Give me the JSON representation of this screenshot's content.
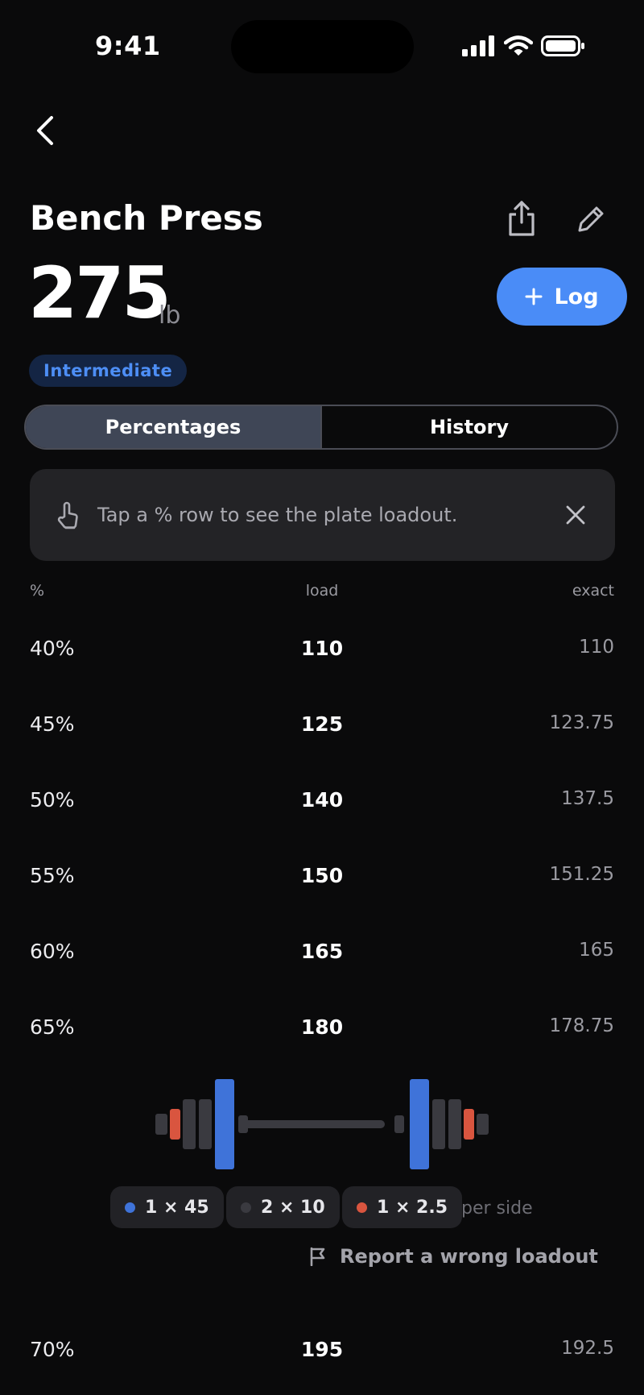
{
  "status_bar": {
    "time": "9:41"
  },
  "header": {
    "title": "Bench Press",
    "weight": "275",
    "unit": "lb",
    "log_label": "Log",
    "level_badge": "Intermediate"
  },
  "tabs": [
    {
      "label": "Percentages",
      "active": true
    },
    {
      "label": "History",
      "active": false
    }
  ],
  "tip": {
    "text": "Tap a % row to see the plate loadout."
  },
  "table": {
    "columns": {
      "pct": "%",
      "load": "load",
      "exact": "exact"
    },
    "rows": [
      {
        "pct": "40%",
        "load": "110",
        "exact": "110"
      },
      {
        "pct": "45%",
        "load": "125",
        "exact": "123.75"
      },
      {
        "pct": "50%",
        "load": "140",
        "exact": "137.5"
      },
      {
        "pct": "55%",
        "load": "150",
        "exact": "151.25"
      },
      {
        "pct": "60%",
        "load": "165",
        "exact": "165"
      },
      {
        "pct": "65%",
        "load": "180",
        "exact": "178.75"
      },
      {
        "pct": "70%",
        "load": "195",
        "exact": "192.5"
      }
    ]
  },
  "loadout": {
    "plates": [
      {
        "label": "1 × 45",
        "color": "#3f73d9"
      },
      {
        "label": "2 × 10",
        "color": "#3a3a40"
      },
      {
        "label": "1 × 2.5",
        "color": "#d9553f"
      }
    ],
    "per_side": "per side",
    "report_label": "Report a wrong loadout"
  },
  "colors": {
    "accent": "#4a8cf7",
    "background": "#0a0a0b",
    "plate_45": "#3f73d9",
    "plate_10": "#3a3a40",
    "plate_2_5": "#d9553f"
  }
}
